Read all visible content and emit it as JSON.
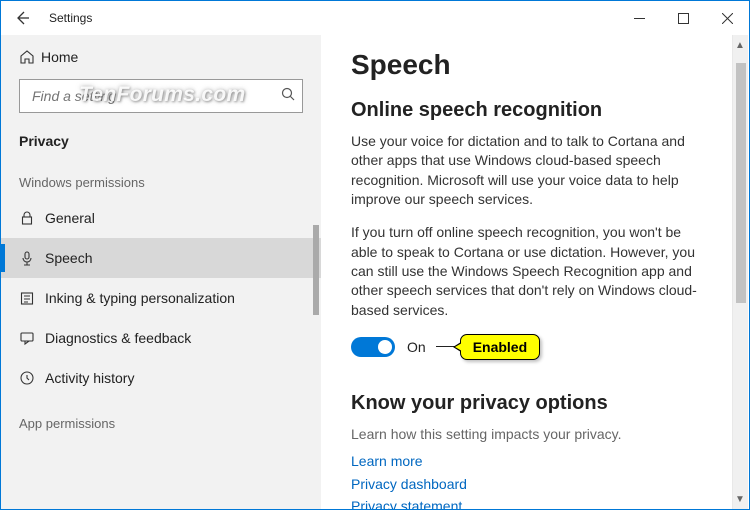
{
  "window": {
    "title": "Settings"
  },
  "watermark": "TenForums.com",
  "sidebar": {
    "home": "Home",
    "search_placeholder": "Find a setting",
    "category": "Privacy",
    "section": "Windows permissions",
    "items": [
      {
        "label": "General"
      },
      {
        "label": "Speech"
      },
      {
        "label": "Inking & typing personalization"
      },
      {
        "label": "Diagnostics & feedback"
      },
      {
        "label": "Activity history"
      }
    ],
    "cutoff": "App permissions"
  },
  "main": {
    "title": "Speech",
    "section1": {
      "heading": "Online speech recognition",
      "p1": "Use your voice for dictation and to talk to Cortana and other apps that use Windows cloud-based speech recognition. Microsoft will use your voice data to help improve our speech services.",
      "p2": "If you turn off online speech recognition, you won't be able to speak to Cortana or use dictation. However, you can still use the Windows Speech Recognition app and other speech services that don't rely on Windows cloud-based services.",
      "toggle_state": "On",
      "callout": "Enabled"
    },
    "section2": {
      "heading": "Know your privacy options",
      "desc": "Learn how this setting impacts your privacy.",
      "links": [
        "Learn more",
        "Privacy dashboard",
        "Privacy statement"
      ]
    }
  }
}
